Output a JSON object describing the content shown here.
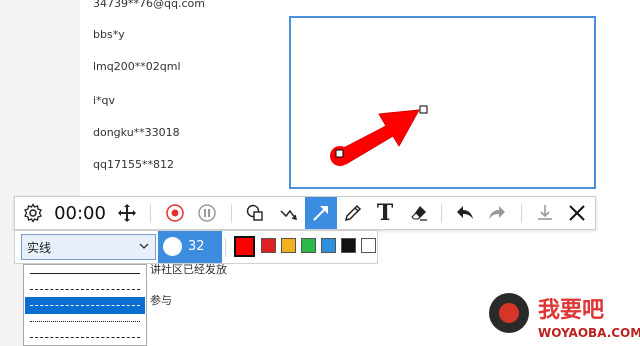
{
  "background_list": {
    "items": [
      "34739**76@qq.com",
      "bbs*y",
      "lmq200**02qml",
      "i*qv",
      "dongku**33018",
      "qq17155**812"
    ],
    "partial_text_1": "讲社区已经发放",
    "partial_text_2": "参与"
  },
  "canvas": {
    "border_color": "#4a90d9",
    "arrow_color": "#ff0000"
  },
  "toolbar": {
    "settings_icon": "gear-icon",
    "timer": "00:00",
    "move_icon": "move-icon",
    "record_icon": "record-icon",
    "pause_icon": "pause-icon",
    "shape_icon": "shape-icon",
    "polyline_icon": "polyline-icon",
    "arrow_icon": "arrow-icon",
    "pencil_icon": "pencil-icon",
    "text_label": "T",
    "eraser_icon": "eraser-icon",
    "undo_icon": "undo-icon",
    "redo_icon": "redo-icon",
    "download_icon": "download-icon",
    "close_icon": "close-icon",
    "active_color": "#3c8de0"
  },
  "subbar": {
    "line_style_selected": "实线",
    "size_value": "32",
    "colors": [
      "#ff0000",
      "#e02020",
      "#f0b020",
      "#2db84a",
      "#2f90e0",
      "#111111",
      "#ffffff"
    ],
    "selected_color": "#ff0000"
  },
  "dropdown": {
    "options": [
      "solid",
      "dashed-1",
      "dashed-2",
      "dashed-3",
      "dash-dot"
    ],
    "selected_index": 2
  },
  "watermark": {
    "title": "我要吧",
    "url": "WOYAOBA.COM"
  }
}
